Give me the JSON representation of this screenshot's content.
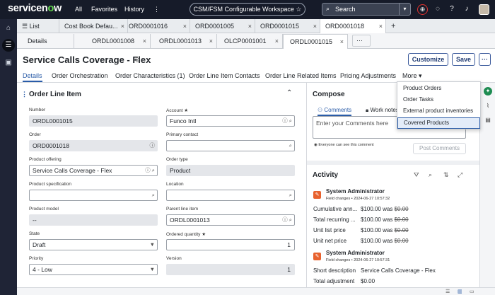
{
  "topbar": {
    "logo_main": "servicen",
    "logo_o": "o",
    "logo_tail": "w",
    "nav": [
      "All",
      "Favorites",
      "History"
    ],
    "more": "⋮",
    "workspace": "CSM/FSM Configurable Workspace ☆",
    "search_label": "Search"
  },
  "tabs1": {
    "list_label": "List",
    "items": [
      "Cost Book Defau...",
      "ORD0001016",
      "ORD0001005",
      "ORD0001015",
      "ORD0001018"
    ],
    "add": "+"
  },
  "tabs2": {
    "items": [
      "Details",
      "ORDL0001008",
      "ORDL0001013",
      "OLCP0001001",
      "ORDL0001015"
    ],
    "overflow": "···"
  },
  "header": {
    "title": "Service Calls Coverage - Flex",
    "customize": "Customize",
    "save": "Save",
    "more": "···"
  },
  "subtabs": [
    "Details",
    "Order Orchestration",
    "Order Characteristics (1)",
    "Order Line Item Contacts",
    "Order Line Related Items",
    "Pricing Adjustments",
    "More ▾"
  ],
  "more_menu": [
    "Product Orders",
    "Order Tasks",
    "External product inventories",
    "Covered Products"
  ],
  "form": {
    "title": "Order Line Item",
    "fields": {
      "number": {
        "label": "Number",
        "value": "ORDL0001015"
      },
      "account": {
        "label": "Account ★",
        "value": "Funco Intl"
      },
      "order": {
        "label": "Order",
        "value": "ORD0001018"
      },
      "primary_contact": {
        "label": "Primary contact",
        "value": ""
      },
      "product_offering": {
        "label": "Product offering",
        "value": "Service Calls Coverage - Flex"
      },
      "order_type": {
        "label": "Order type",
        "value": "Product"
      },
      "product_specification": {
        "label": "Product specification",
        "value": ""
      },
      "location": {
        "label": "Location",
        "value": ""
      },
      "product_model": {
        "label": "Product model",
        "value": "--"
      },
      "parent_line_item": {
        "label": "Parent line item",
        "value": "ORDL0001013"
      },
      "state": {
        "label": "State",
        "value": "Draft"
      },
      "ordered_quantity": {
        "label": "Ordered quantity ★",
        "value": "1"
      },
      "priority": {
        "label": "Priority",
        "value": "4 - Low"
      },
      "version": {
        "label": "Version",
        "value": "1"
      }
    }
  },
  "compose": {
    "title": "Compose",
    "tab_comments": "Comments",
    "tab_work": "Work notes",
    "placeholder": "Enter your Comments here",
    "visibility": "Everyone can see this comment",
    "post": "Post Comments"
  },
  "activity": {
    "title": "Activity",
    "entries": [
      {
        "author": "System Administrator",
        "meta": "Field changes • 2024-06-27 10:57:32",
        "rows": [
          {
            "field": "Cumulative ann...",
            "new": "$100.00 was",
            "old": "$0.00"
          },
          {
            "field": "Total recurring ...",
            "new": "$100.00 was",
            "old": "$0.00"
          },
          {
            "field": "Unit list price",
            "new": "$100.00 was",
            "old": "$0.00"
          },
          {
            "field": "Unit net price",
            "new": "$100.00 was",
            "old": "$0.00"
          }
        ]
      },
      {
        "author": "System Administrator",
        "meta": "Field changes • 2024-06-27 10:57:31",
        "rows": [
          {
            "field": "Short description",
            "new": "Service Calls Coverage - Flex",
            "old": ""
          },
          {
            "field": "Total adjustment",
            "new": "$0.00",
            "old": ""
          }
        ]
      }
    ]
  }
}
